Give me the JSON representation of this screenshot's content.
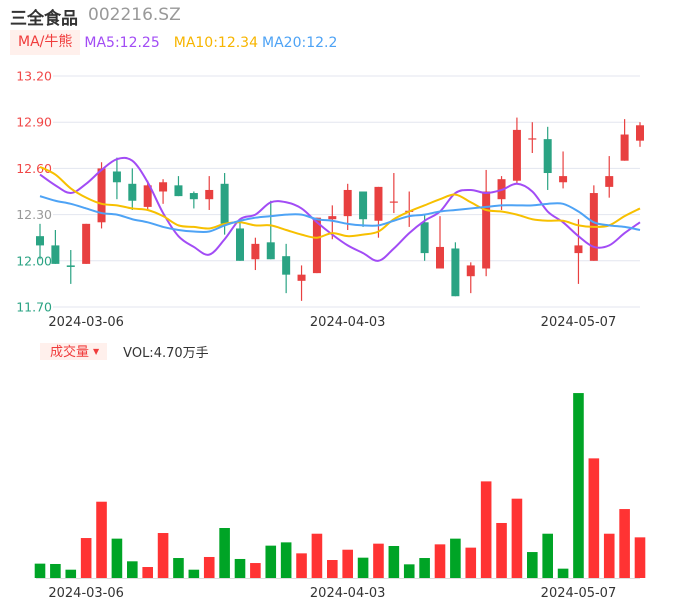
{
  "header": {
    "name": "三全食品",
    "code": "002216.SZ"
  },
  "ma_legend": {
    "tag": "MA/牛熊",
    "ma5": "MA5:12.25",
    "ma10": "MA10:12.34",
    "ma20": "MA20:12.2"
  },
  "volume_legend": {
    "tag": "成交量",
    "arrow": "▼",
    "value": "VOL:4.70万手"
  },
  "colors": {
    "up": "#e84040",
    "down": "#2aa383",
    "vol_up": "#ff3333",
    "vol_down": "#00a426",
    "ma5": "#a24cf5",
    "ma10": "#f7c000",
    "ma20": "#4ea3f5",
    "grid": "#e3e6ef"
  },
  "chart_data": {
    "type": "candlestick",
    "y_ticks": [
      "13.20",
      "12.90",
      "12.60",
      "12.30",
      "12.00",
      "11.70"
    ],
    "ylim": [
      11.7,
      13.2
    ],
    "x_labels": [
      {
        "index": 3,
        "label": "2024-03-06"
      },
      {
        "index": 20,
        "label": "2024-04-03"
      },
      {
        "index": 35,
        "label": "2024-05-07"
      }
    ],
    "ohlc": [
      [
        12.16,
        12.24,
        12.01,
        12.1
      ],
      [
        12.1,
        12.2,
        11.98,
        11.98
      ],
      [
        11.97,
        12.07,
        11.85,
        11.96
      ],
      [
        11.98,
        12.24,
        11.98,
        12.24
      ],
      [
        12.25,
        12.64,
        12.21,
        12.6
      ],
      [
        12.58,
        12.67,
        12.4,
        12.51
      ],
      [
        12.5,
        12.6,
        12.33,
        12.39
      ],
      [
        12.35,
        12.52,
        12.33,
        12.49
      ],
      [
        12.45,
        12.53,
        12.37,
        12.51
      ],
      [
        12.49,
        12.55,
        12.42,
        12.42
      ],
      [
        12.44,
        12.45,
        12.34,
        12.4
      ],
      [
        12.4,
        12.55,
        12.33,
        12.46
      ],
      [
        12.5,
        12.57,
        12.17,
        12.24
      ],
      [
        12.21,
        12.25,
        12.0,
        12.0
      ],
      [
        12.01,
        12.15,
        11.94,
        12.11
      ],
      [
        12.12,
        12.39,
        12.01,
        12.01
      ],
      [
        12.03,
        12.11,
        11.79,
        11.91
      ],
      [
        11.87,
        11.97,
        11.74,
        11.91
      ],
      [
        11.92,
        12.28,
        11.92,
        12.28
      ],
      [
        12.27,
        12.36,
        12.14,
        12.29
      ],
      [
        12.29,
        12.5,
        12.2,
        12.46
      ],
      [
        12.45,
        12.45,
        12.22,
        12.27
      ],
      [
        12.26,
        12.48,
        12.15,
        12.48
      ],
      [
        12.38,
        12.57,
        12.31,
        12.385
      ],
      [
        12.32,
        12.45,
        12.22,
        12.325
      ],
      [
        12.25,
        12.3,
        12.0,
        12.05
      ],
      [
        11.95,
        12.29,
        11.95,
        12.09
      ],
      [
        12.08,
        12.12,
        11.77,
        11.77
      ],
      [
        11.9,
        11.99,
        11.79,
        11.97
      ],
      [
        11.95,
        12.59,
        11.9,
        12.45
      ],
      [
        12.4,
        12.55,
        12.33,
        12.53
      ],
      [
        12.52,
        12.93,
        12.5,
        12.85
      ],
      [
        12.79,
        12.9,
        12.7,
        12.795
      ],
      [
        12.79,
        12.87,
        12.46,
        12.57
      ],
      [
        12.51,
        12.71,
        12.47,
        12.55
      ],
      [
        12.05,
        12.27,
        11.85,
        12.1
      ],
      [
        12.0,
        12.49,
        12.0,
        12.44
      ],
      [
        12.48,
        12.68,
        12.41,
        12.55
      ],
      [
        12.65,
        12.92,
        12.65,
        12.82
      ],
      [
        12.78,
        12.9,
        12.74,
        12.88
      ]
    ],
    "ma5": [
      12.56,
      12.49,
      12.44,
      12.5,
      12.59,
      12.66,
      12.65,
      12.51,
      12.31,
      12.16,
      12.09,
      12.04,
      12.14,
      12.27,
      12.3,
      12.38,
      12.38,
      12.34,
      12.25,
      12.17,
      12.1,
      12.05,
      12.0,
      12.08,
      12.18,
      12.26,
      12.32,
      12.44,
      12.46,
      12.44,
      12.46,
      12.5,
      12.45,
      12.32,
      12.25,
      12.16,
      12.09,
      12.1,
      12.18,
      12.25
    ],
    "ma10": [
      12.61,
      12.56,
      12.47,
      12.41,
      12.37,
      12.36,
      12.34,
      12.33,
      12.29,
      12.23,
      12.22,
      12.21,
      12.24,
      12.25,
      12.23,
      12.23,
      12.2,
      12.17,
      12.15,
      12.18,
      12.16,
      12.17,
      12.19,
      12.27,
      12.32,
      12.36,
      12.4,
      12.43,
      12.38,
      12.33,
      12.32,
      12.3,
      12.27,
      12.26,
      12.26,
      12.23,
      12.22,
      12.23,
      12.29,
      12.34
    ],
    "ma20": [
      12.42,
      12.39,
      12.37,
      12.34,
      12.31,
      12.3,
      12.27,
      12.25,
      12.22,
      12.2,
      12.19,
      12.19,
      12.23,
      12.26,
      12.28,
      12.29,
      12.3,
      12.3,
      12.27,
      12.26,
      12.24,
      12.23,
      12.23,
      12.26,
      12.29,
      12.3,
      12.32,
      12.33,
      12.34,
      12.35,
      12.36,
      12.36,
      12.36,
      12.37,
      12.37,
      12.32,
      12.25,
      12.23,
      12.22,
      12.2
    ],
    "volume_unit": "万手",
    "volume": [
      1.66,
      1.62,
      0.96,
      4.62,
      8.82,
      4.55,
      1.93,
      1.27,
      5.2,
      2.31,
      0.96,
      2.43,
      5.78,
      2.2,
      1.73,
      3.74,
      4.12,
      2.85,
      5.12,
      2.08,
      3.27,
      2.35,
      3.97,
      3.7,
      1.58,
      2.31,
      3.89,
      4.55,
      3.51,
      11.17,
      6.36,
      9.17,
      3.0,
      5.12,
      1.08,
      21.38,
      13.83,
      5.12,
      7.97,
      4.7
    ],
    "volume_up": [
      0,
      0,
      0,
      1,
      1,
      0,
      0,
      1,
      1,
      0,
      0,
      1,
      0,
      0,
      1,
      0,
      0,
      1,
      1,
      1,
      1,
      0,
      1,
      0,
      0,
      0,
      1,
      0,
      1,
      1,
      1,
      1,
      0,
      0,
      0,
      0,
      1,
      1,
      1,
      1
    ]
  }
}
